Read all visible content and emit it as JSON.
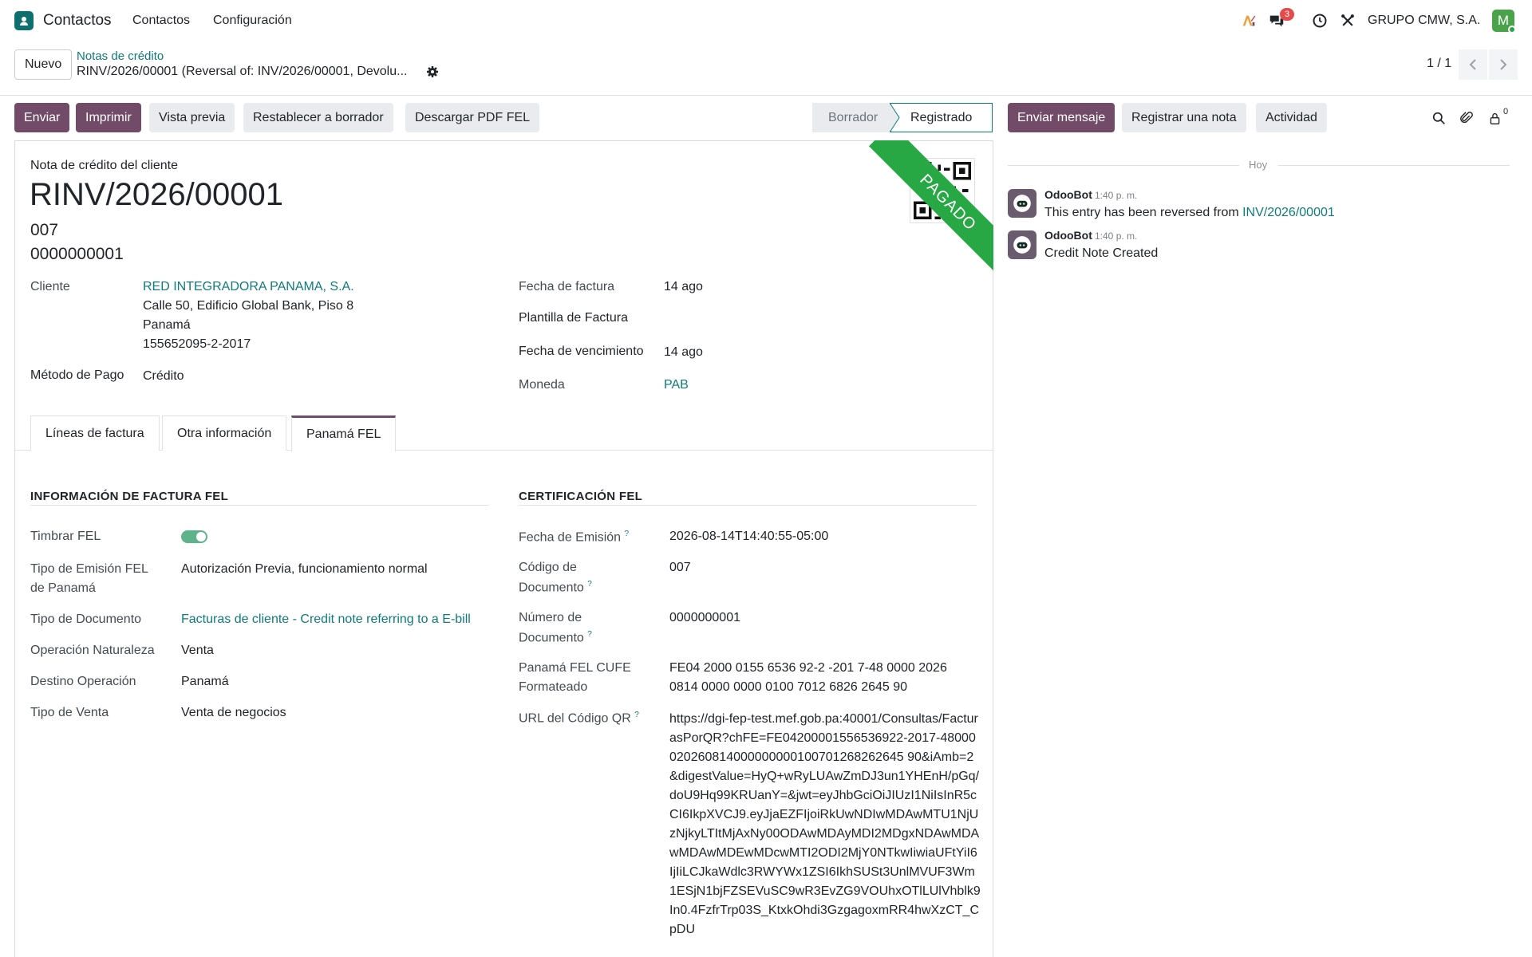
{
  "navbar": {
    "app_name": "Contactos",
    "menu": [
      "Contactos",
      "Configuración"
    ],
    "notification_count": "3",
    "company": "GRUPO CMW, S.A.",
    "avatar_letter": "M"
  },
  "control": {
    "new_button": "Nuevo",
    "breadcrumb": "Notas de crédito",
    "record_title": "RINV/2026/00001 (Reversal of: INV/2026/00001, Devolu...",
    "pager": "1 / 1"
  },
  "actions": {
    "send": "Enviar",
    "print": "Imprimir",
    "preview": "Vista previa",
    "reset": "Restablecer a borrador",
    "download_pdf": "Descargar PDF FEL"
  },
  "status": {
    "steps": [
      "Borrador",
      "Registrado"
    ],
    "current": "Registrado"
  },
  "document": {
    "type_label": "Nota de crédito del cliente",
    "name": "RINV/2026/00001",
    "code": "007",
    "number": "0000000001",
    "ribbon": "PAGADO",
    "fields_left": {
      "customer_label": "Cliente",
      "customer_name": "RED INTEGRADORA PANAMA, S.A.",
      "customer_address1": "Calle 50, Edificio Global Bank, Piso 8",
      "customer_address2": "Panamá",
      "customer_ruc": "155652095-2-2017",
      "payment_method_label": "Método de Pago",
      "payment_method": "Crédito"
    },
    "fields_right": {
      "invoice_date_label": "Fecha de factura",
      "invoice_date": "14 ago",
      "template_label": "Plantilla de Factura",
      "due_date_label": "Fecha de vencimiento",
      "due_date": "14 ago",
      "currency_label": "Moneda",
      "currency": "PAB"
    }
  },
  "tabs": [
    "Líneas de factura",
    "Otra información",
    "Panamá FEL"
  ],
  "active_tab": "Panamá FEL",
  "fel_info": {
    "title": "INFORMACIÓN DE FACTURA FEL",
    "timbrar_label": "Timbrar FEL",
    "timbrar_value": true,
    "emission_type_label_1": "Tipo de Emisión FEL",
    "emission_type_label_2": "de Panamá",
    "emission_type": "Autorización Previa, funcionamiento normal",
    "doc_type_label": "Tipo de Documento",
    "doc_type": "Facturas de cliente - Credit note referring to a E-bill",
    "nature_label": "Operación Naturaleza",
    "nature": "Venta",
    "destination_label": "Destino Operación",
    "destination": "Panamá",
    "sale_type_label": "Tipo de Venta",
    "sale_type": "Venta de negocios"
  },
  "fel_cert": {
    "title": "CERTIFICACIÓN FEL",
    "emission_date_label": "Fecha de Emisión",
    "emission_date": "2026-08-14T14:40:55-05:00",
    "doc_code_label_1": "Código de",
    "doc_code_label_2": "Documento",
    "doc_code": "007",
    "doc_number_label_1": "Número de",
    "doc_number_label_2": "Documento",
    "doc_number": "0000000001",
    "cufe_label_1": "Panamá FEL CUFE",
    "cufe_label_2": "Formateado",
    "cufe_line1": "FE04 2000 0155 6536 92-2 -201 7-48 0000 2026",
    "cufe_line2": "0814 0000 0000 0100 7012 6826 2645 90",
    "qr_url_label": "URL del Código QR",
    "qr_url": "https://dgi-fep-test.mef.gob.pa:40001/Consultas/FacturasPorQR?chFE=FE04200001556536922-2017-48000020260814000000000100701268262645 90&iAmb=2&digestValue=HyQ+wRyLUAwZmDJ3un1YHEnH/pGq/doU9Hq99KRUanY=&jwt=eyJhbGciOiJIUzI1NiIsInR5cCI6IkpXVCJ9.eyJjaEZFIjoiRkUwNDIwMDAwMTU1NjUzNjkyLTItMjAxNy00ODAwMDAyMDI2MDgxNDAwMDAwMDAwMDEwMDcwMTI2ODI2MjY0NTkwIiwiaUFtYiI6IjIiLCJkaWdlc3RWYWx1ZSI6IkhSUSt3UnlMVUF3Wm1ESjN1bjFZSEVuSC9wR3EvZG9VOUhxOTlLUlVhblk9In0.4FzfrTrp03S_KtxkOhdi3GzgagoxmRR4hwXzCT_CpDU",
    "help_mark": "?"
  },
  "chatter": {
    "send_message": "Enviar mensaje",
    "log_note": "Registrar una nota",
    "activity": "Actividad",
    "followers_count": "0",
    "today": "Hoy",
    "messages": [
      {
        "author": "OdooBot",
        "time": "1:40 p. m.",
        "text": "This entry has been reversed from ",
        "link": "INV/2026/00001"
      },
      {
        "author": "OdooBot",
        "time": "1:40 p. m.",
        "text": "Credit Note Created",
        "link": ""
      }
    ]
  },
  "colors": {
    "primary": "#714b67",
    "link": "#0f7b7b",
    "ribbon": "#28a745",
    "badge": "#e34b4b"
  }
}
